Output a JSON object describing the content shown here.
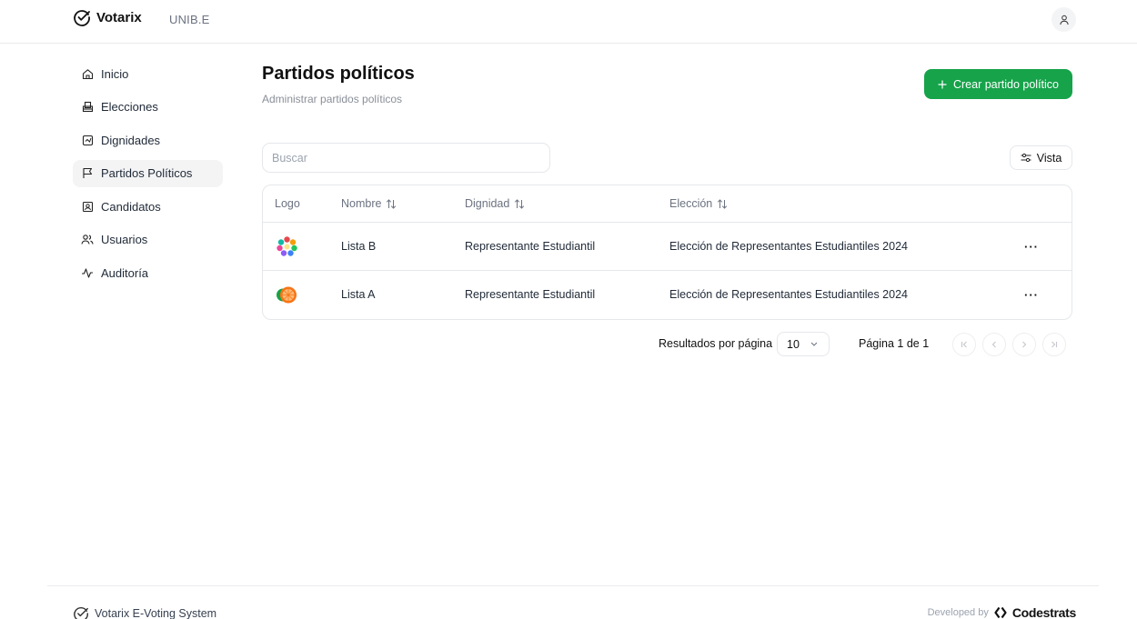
{
  "header": {
    "app_name": "Votarix",
    "org": "UNIB.E"
  },
  "sidebar": {
    "items": [
      {
        "label": "Inicio",
        "icon": "home-icon"
      },
      {
        "label": "Elecciones",
        "icon": "ballot-box-icon"
      },
      {
        "label": "Dignidades",
        "icon": "checkbox-square-icon"
      },
      {
        "label": "Partidos Políticos",
        "icon": "flag-icon",
        "active": true
      },
      {
        "label": "Candidatos",
        "icon": "id-card-icon"
      },
      {
        "label": "Usuarios",
        "icon": "users-icon"
      },
      {
        "label": "Auditoría",
        "icon": "activity-icon"
      }
    ]
  },
  "main": {
    "title": "Partidos políticos",
    "subtitle": "Administrar partidos políticos",
    "create_button": "Crear partido político",
    "search_placeholder": "Buscar",
    "view_button": "Vista"
  },
  "table": {
    "headers": {
      "logo": "Logo",
      "nombre": "Nombre",
      "dignidad": "Dignidad",
      "eleccion": "Elección"
    },
    "rows": [
      {
        "nombre": "Lista B",
        "dignidad": "Representante Estudiantil",
        "eleccion": "Elección de Representantes Estudiantiles 2024",
        "logo": "colorful-flower-logo"
      },
      {
        "nombre": "Lista A",
        "dignidad": "Representante Estudiantil",
        "eleccion": "Elección de Representantes Estudiantiles 2024",
        "logo": "orange-fruit-logo"
      }
    ]
  },
  "pagination": {
    "per_page_label": "Resultados por página",
    "per_page_value": "10",
    "page_info": "Página 1 de 1"
  },
  "footer": {
    "system_name": "Votarix E-Voting System",
    "developed_by": "Developed by",
    "company": "Codestrats"
  },
  "colors": {
    "accent": "#16a34a",
    "active_nav_bg": "#f4f4f5",
    "border": "#e5e7eb"
  }
}
